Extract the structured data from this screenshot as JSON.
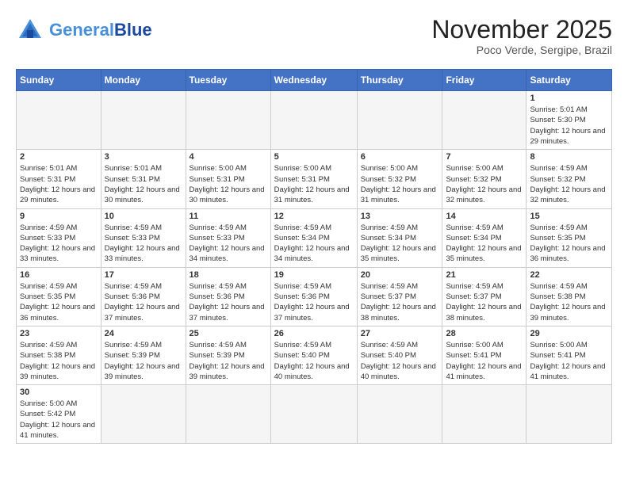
{
  "logo": {
    "general": "General",
    "blue": "Blue"
  },
  "title": "November 2025",
  "subtitle": "Poco Verde, Sergipe, Brazil",
  "weekdays": [
    "Sunday",
    "Monday",
    "Tuesday",
    "Wednesday",
    "Thursday",
    "Friday",
    "Saturday"
  ],
  "weeks": [
    [
      {
        "day": "",
        "info": ""
      },
      {
        "day": "",
        "info": ""
      },
      {
        "day": "",
        "info": ""
      },
      {
        "day": "",
        "info": ""
      },
      {
        "day": "",
        "info": ""
      },
      {
        "day": "",
        "info": ""
      },
      {
        "day": "1",
        "info": "Sunrise: 5:01 AM\nSunset: 5:30 PM\nDaylight: 12 hours and 29 minutes."
      }
    ],
    [
      {
        "day": "2",
        "info": "Sunrise: 5:01 AM\nSunset: 5:31 PM\nDaylight: 12 hours and 29 minutes."
      },
      {
        "day": "3",
        "info": "Sunrise: 5:01 AM\nSunset: 5:31 PM\nDaylight: 12 hours and 30 minutes."
      },
      {
        "day": "4",
        "info": "Sunrise: 5:00 AM\nSunset: 5:31 PM\nDaylight: 12 hours and 30 minutes."
      },
      {
        "day": "5",
        "info": "Sunrise: 5:00 AM\nSunset: 5:31 PM\nDaylight: 12 hours and 31 minutes."
      },
      {
        "day": "6",
        "info": "Sunrise: 5:00 AM\nSunset: 5:32 PM\nDaylight: 12 hours and 31 minutes."
      },
      {
        "day": "7",
        "info": "Sunrise: 5:00 AM\nSunset: 5:32 PM\nDaylight: 12 hours and 32 minutes."
      },
      {
        "day": "8",
        "info": "Sunrise: 4:59 AM\nSunset: 5:32 PM\nDaylight: 12 hours and 32 minutes."
      }
    ],
    [
      {
        "day": "9",
        "info": "Sunrise: 4:59 AM\nSunset: 5:33 PM\nDaylight: 12 hours and 33 minutes."
      },
      {
        "day": "10",
        "info": "Sunrise: 4:59 AM\nSunset: 5:33 PM\nDaylight: 12 hours and 33 minutes."
      },
      {
        "day": "11",
        "info": "Sunrise: 4:59 AM\nSunset: 5:33 PM\nDaylight: 12 hours and 34 minutes."
      },
      {
        "day": "12",
        "info": "Sunrise: 4:59 AM\nSunset: 5:34 PM\nDaylight: 12 hours and 34 minutes."
      },
      {
        "day": "13",
        "info": "Sunrise: 4:59 AM\nSunset: 5:34 PM\nDaylight: 12 hours and 35 minutes."
      },
      {
        "day": "14",
        "info": "Sunrise: 4:59 AM\nSunset: 5:34 PM\nDaylight: 12 hours and 35 minutes."
      },
      {
        "day": "15",
        "info": "Sunrise: 4:59 AM\nSunset: 5:35 PM\nDaylight: 12 hours and 36 minutes."
      }
    ],
    [
      {
        "day": "16",
        "info": "Sunrise: 4:59 AM\nSunset: 5:35 PM\nDaylight: 12 hours and 36 minutes."
      },
      {
        "day": "17",
        "info": "Sunrise: 4:59 AM\nSunset: 5:36 PM\nDaylight: 12 hours and 37 minutes."
      },
      {
        "day": "18",
        "info": "Sunrise: 4:59 AM\nSunset: 5:36 PM\nDaylight: 12 hours and 37 minutes."
      },
      {
        "day": "19",
        "info": "Sunrise: 4:59 AM\nSunset: 5:36 PM\nDaylight: 12 hours and 37 minutes."
      },
      {
        "day": "20",
        "info": "Sunrise: 4:59 AM\nSunset: 5:37 PM\nDaylight: 12 hours and 38 minutes."
      },
      {
        "day": "21",
        "info": "Sunrise: 4:59 AM\nSunset: 5:37 PM\nDaylight: 12 hours and 38 minutes."
      },
      {
        "day": "22",
        "info": "Sunrise: 4:59 AM\nSunset: 5:38 PM\nDaylight: 12 hours and 39 minutes."
      }
    ],
    [
      {
        "day": "23",
        "info": "Sunrise: 4:59 AM\nSunset: 5:38 PM\nDaylight: 12 hours and 39 minutes."
      },
      {
        "day": "24",
        "info": "Sunrise: 4:59 AM\nSunset: 5:39 PM\nDaylight: 12 hours and 39 minutes."
      },
      {
        "day": "25",
        "info": "Sunrise: 4:59 AM\nSunset: 5:39 PM\nDaylight: 12 hours and 39 minutes."
      },
      {
        "day": "26",
        "info": "Sunrise: 4:59 AM\nSunset: 5:40 PM\nDaylight: 12 hours and 40 minutes."
      },
      {
        "day": "27",
        "info": "Sunrise: 4:59 AM\nSunset: 5:40 PM\nDaylight: 12 hours and 40 minutes."
      },
      {
        "day": "28",
        "info": "Sunrise: 5:00 AM\nSunset: 5:41 PM\nDaylight: 12 hours and 41 minutes."
      },
      {
        "day": "29",
        "info": "Sunrise: 5:00 AM\nSunset: 5:41 PM\nDaylight: 12 hours and 41 minutes."
      }
    ],
    [
      {
        "day": "30",
        "info": "Sunrise: 5:00 AM\nSunset: 5:42 PM\nDaylight: 12 hours and 41 minutes."
      },
      {
        "day": "",
        "info": ""
      },
      {
        "day": "",
        "info": ""
      },
      {
        "day": "",
        "info": ""
      },
      {
        "day": "",
        "info": ""
      },
      {
        "day": "",
        "info": ""
      },
      {
        "day": "",
        "info": ""
      }
    ]
  ]
}
